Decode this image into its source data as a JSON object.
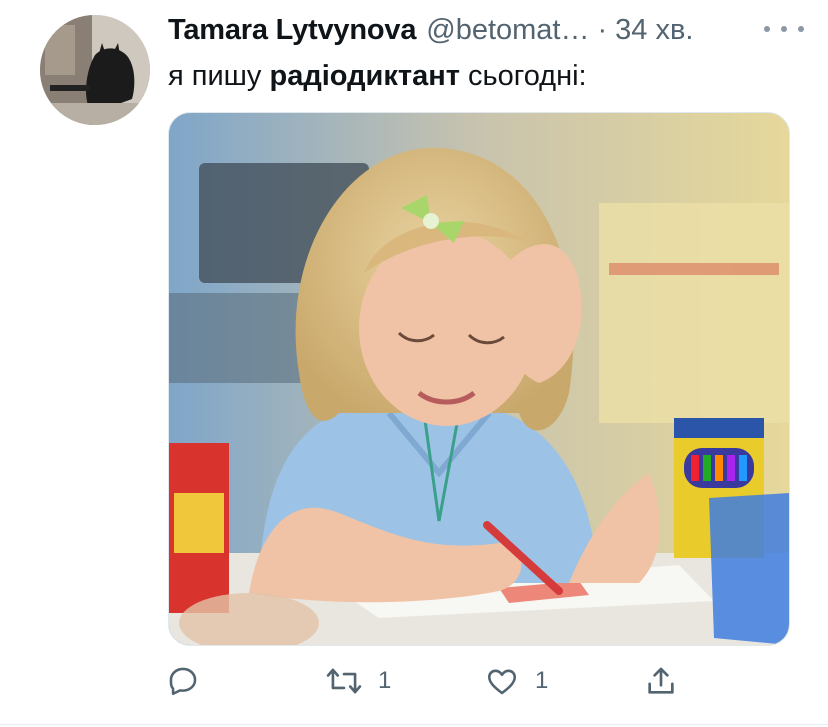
{
  "tweet": {
    "author_name": "Tamara Lytvynova",
    "handle": "@betomat…",
    "separator": "·",
    "time": "34 хв.",
    "text_before": "я пишу ",
    "text_bold": "радіодиктант",
    "text_after": " сьогодні:",
    "more_icon": "more-horizontal-icon",
    "avatar": "user-avatar",
    "media_description": "photo of crying girl drawing with crayons"
  },
  "actions": {
    "reply_count": "",
    "retweet_count": "1",
    "like_count": "1",
    "share_count": ""
  },
  "colors": {
    "text_primary": "#0f1419",
    "text_secondary": "#536471",
    "icon": "#536471"
  }
}
